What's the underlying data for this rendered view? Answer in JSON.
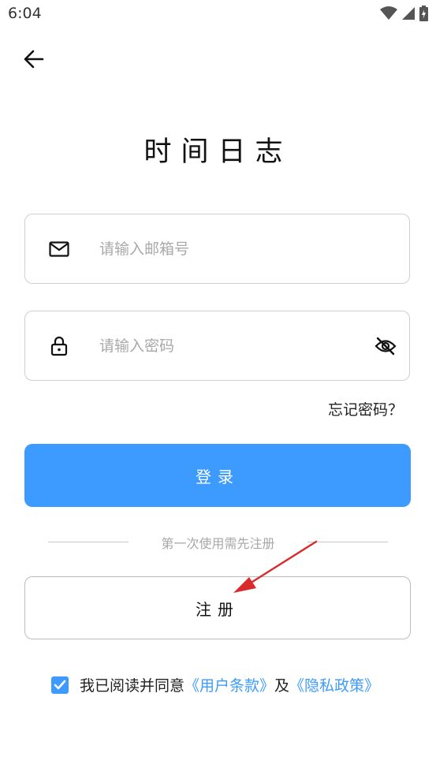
{
  "status_bar": {
    "time": "6:04"
  },
  "app": {
    "title": "时间日志"
  },
  "email_field": {
    "placeholder": "请输入邮箱号"
  },
  "password_field": {
    "placeholder": "请输入密码"
  },
  "forgot_password": "忘记密码？",
  "login_button": "登录",
  "divider_text": "第一次使用需先注册",
  "register_button": "注册",
  "agreement": {
    "prefix": "我已阅读并同意",
    "terms_link": "《用户条款》",
    "conjunction": "及",
    "privacy_link": "《隐私政策》",
    "checked": true
  },
  "colors": {
    "accent": "#3d9bff",
    "annotation_arrow": "#d92b2b"
  },
  "icons": [
    "wifi-icon",
    "cellular-signal-icon",
    "battery-icon",
    "back-arrow-icon",
    "mail-icon",
    "lock-icon",
    "eye-off-icon",
    "checkmark-icon"
  ]
}
